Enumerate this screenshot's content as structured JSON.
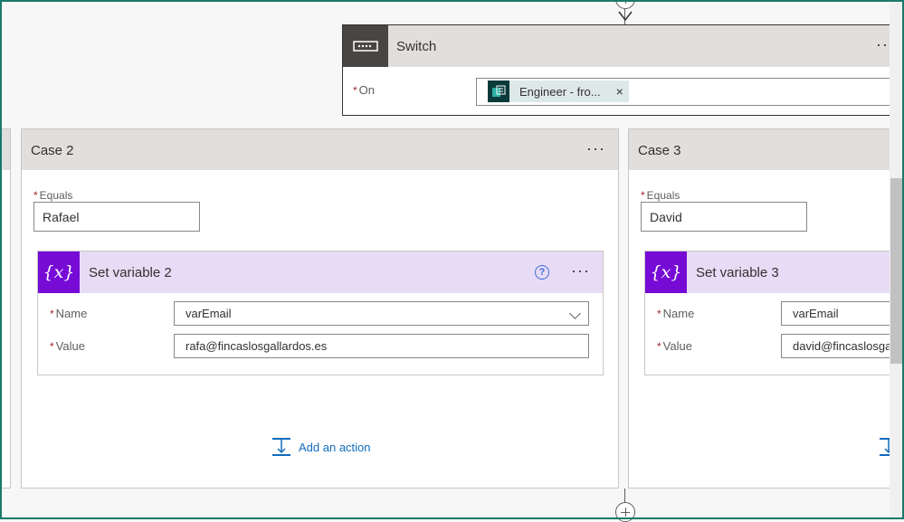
{
  "switch": {
    "title": "Switch",
    "more": "···",
    "on_label": "On",
    "required_mark": "*",
    "token_text": "Engineer - fro...",
    "token_remove": "×"
  },
  "cases": [
    {
      "title": "Case 2",
      "more": "···",
      "equals_label": "Equals",
      "equals_value": "Rafael",
      "action": {
        "title": "Set variable 2",
        "icon_text": "{x}",
        "help": "?",
        "more": "···",
        "name_label": "Name",
        "name_value": "varEmail",
        "value_label": "Value",
        "value_value": "rafa@fincaslosgallardos.es"
      },
      "add_action": "Add an action"
    },
    {
      "title": "Case 3",
      "equals_label": "Equals",
      "equals_value": "David",
      "action": {
        "title": "Set variable 3",
        "icon_text": "{x}",
        "name_label": "Name",
        "name_value": "varEmail",
        "value_label": "Value",
        "value_value": "david@fincaslosgallardos.es"
      }
    }
  ],
  "icons": {
    "switch": "switch-icon",
    "variable": "variable-icon",
    "add_action": "add-action-icon",
    "plus": "add-step-icon",
    "arrow": "down-arrow-icon"
  },
  "colors": {
    "frame": "#1a7a6a",
    "variable_purple": "#770bd6",
    "action_header": "#e8dbf5",
    "link_blue": "#0f6cbd",
    "required_red": "#a4262c"
  }
}
